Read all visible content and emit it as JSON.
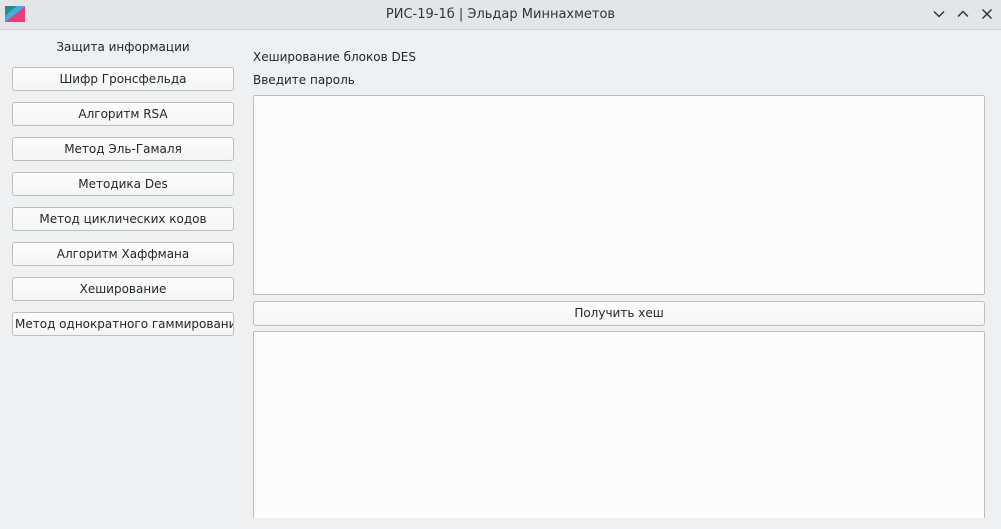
{
  "window": {
    "title": "РИС-19-1б | Эльдар Миннахметов",
    "icons": {
      "app": "app-icon",
      "minimize": "chevron-down-icon",
      "maximize": "chevron-up-icon",
      "close": "close-icon"
    }
  },
  "sidebar": {
    "title": "Защита информации",
    "items": [
      {
        "label": "Шифр Гронсфельда"
      },
      {
        "label": "Алгоритм RSA"
      },
      {
        "label": "Метод Эль-Гамаля"
      },
      {
        "label": "Методика Des"
      },
      {
        "label": "Метод циклических кодов"
      },
      {
        "label": "Алгоритм Хаффмана"
      },
      {
        "label": "Хеширование"
      },
      {
        "label": "Метод однократного гаммирования"
      }
    ]
  },
  "main": {
    "section_title": "Хеширование блоков DES",
    "password_label": "Введите пароль",
    "password_value": "",
    "hash_button": "Получить хеш",
    "output_value": ""
  },
  "colors": {
    "background": "#eff0f1",
    "titlebar": "#e3e5e7",
    "field": "#fcfcfc",
    "border": "#bcbebf"
  }
}
